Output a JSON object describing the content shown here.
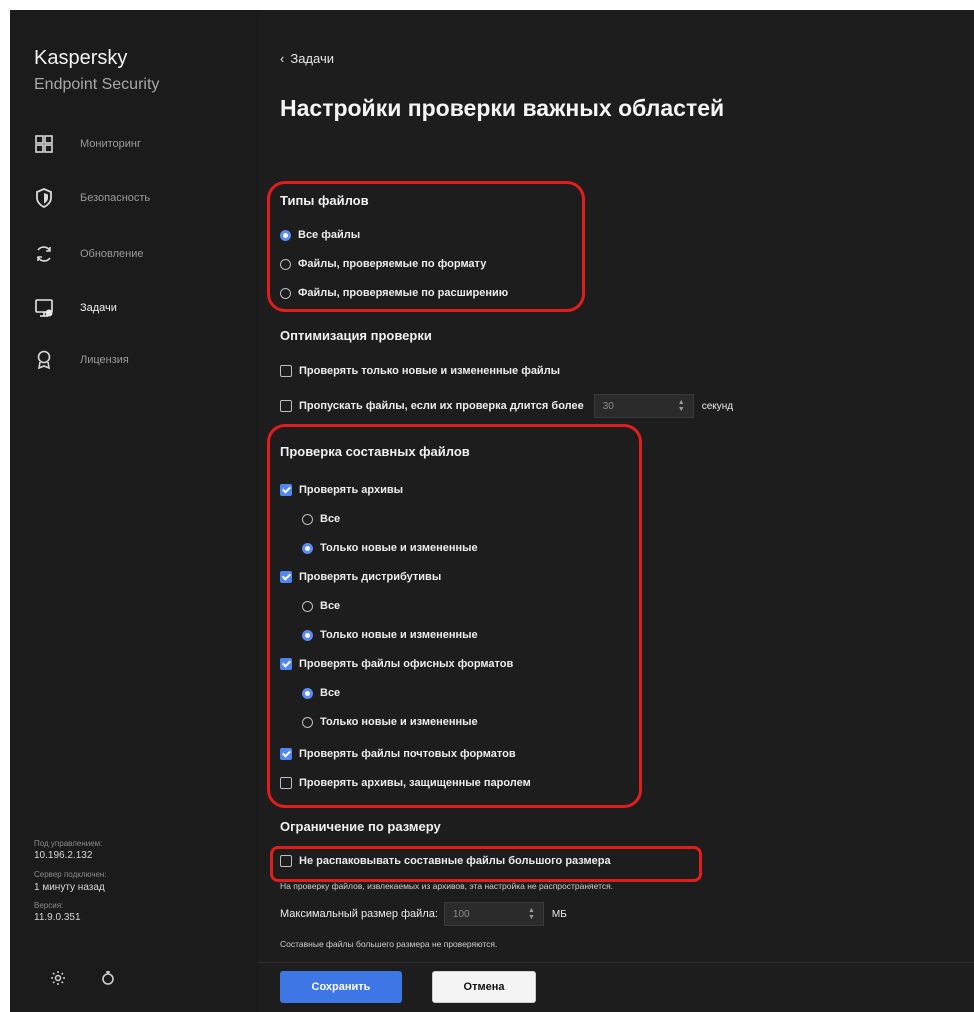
{
  "window": {
    "help": "?",
    "minimize": "–",
    "close": "×"
  },
  "sidebar": {
    "brand_line1": "Kaspersky",
    "brand_line2": "Endpoint Security",
    "items": [
      {
        "label": "Мониторинг",
        "icon": "monitoring-grid-icon"
      },
      {
        "label": "Безопасность",
        "icon": "shield-icon"
      },
      {
        "label": "Обновление",
        "icon": "refresh-icon"
      },
      {
        "label": "Задачи",
        "icon": "tasks-icon",
        "active": true
      },
      {
        "label": "Лицензия",
        "icon": "license-medal-icon"
      }
    ],
    "managed_label": "Под управлением:",
    "managed_value": "10.196.2.132",
    "server_label": "Сервер подключен:",
    "server_value": "1 минуту назад",
    "version_label": "Версия:",
    "version_value": "11.9.0.351"
  },
  "main": {
    "back_label": "Задачи",
    "title": "Настройки проверки важных областей",
    "file_types": {
      "header": "Типы файлов",
      "options": [
        {
          "label": "Все файлы",
          "selected": true
        },
        {
          "label": "Файлы, проверяемые по формату",
          "selected": false
        },
        {
          "label": "Файлы, проверяемые по расширению",
          "selected": false
        }
      ]
    },
    "optimization": {
      "header": "Оптимизация проверки",
      "only_new_label": "Проверять только новые и измененные файлы",
      "skip_label": "Пропускать файлы, если их проверка длится более",
      "skip_value": "30",
      "skip_unit": "секунд"
    },
    "compound": {
      "header": "Проверка составных файлов",
      "archives_label": "Проверять архивы",
      "archives_all": "Все",
      "archives_new": "Только новые и измененные",
      "distrib_label": "Проверять дистрибутивы",
      "distrib_all": "Все",
      "distrib_new": "Только новые и измененные",
      "office_label": "Проверять файлы офисных форматов",
      "office_all": "Все",
      "office_new": "Только новые и измененные",
      "mail_label": "Проверять файлы почтовых форматов",
      "protected_label": "Проверять архивы, защищенные паролем"
    },
    "size_limit": {
      "header": "Ограничение по размеру",
      "no_unpack_label": "Не распаковывать составные файлы большого размера",
      "hint1": "На проверку файлов, извлекаемых из архивов, эта настройка не распространяется.",
      "max_label": "Максимальный размер файла:",
      "max_value": "100",
      "max_unit": "МБ",
      "hint2": "Составные файлы большего размера не проверяются."
    }
  },
  "footer": {
    "save": "Сохранить",
    "cancel": "Отмена"
  },
  "colors": {
    "accent": "#4f86f0",
    "highlight": "#e01e1e",
    "background": "#1d1d1d"
  }
}
